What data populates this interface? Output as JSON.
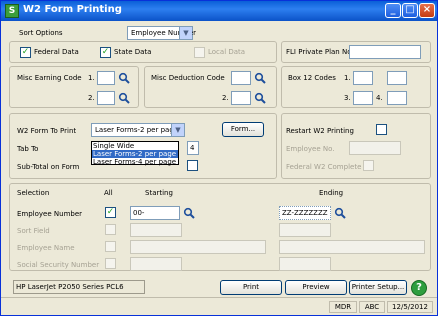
{
  "window": {
    "title": "W2 Form Printing"
  },
  "sort": {
    "label": "Sort Options",
    "value": "Employee Number"
  },
  "options": {
    "federal": "Federal Data",
    "state": "State Data",
    "local": "Local Data",
    "fli_label": "FLI Private Plan No.",
    "fli_value": ""
  },
  "misc_earning": {
    "label": "Misc Earning Code",
    "n1": "1.",
    "n2": "2."
  },
  "misc_deduction": {
    "label": "Misc Deduction Code",
    "n1": "1.",
    "n2": "2."
  },
  "box12": {
    "label": "Box 12 Codes",
    "n1": "1.",
    "n2": "2.",
    "n3": "3.",
    "n4": "4."
  },
  "print_opts": {
    "form_label": "W2 Form To Print",
    "form_value": "Laser Forms-2 per page",
    "tab_label": "Tab To",
    "tab_value": "4",
    "subtotal_label": "Sub-Total on Form",
    "form_btn": "Form...",
    "dropdown": [
      "Single Wide",
      "Laser Forms-2 per page",
      "Laser Forms-4 per page"
    ]
  },
  "restart": {
    "label": "Restart W2 Printing",
    "employee_label": "Employee No.",
    "federal_complete": "Federal W2 Complete"
  },
  "selection": {
    "header_selection": "Selection",
    "header_all": "All",
    "header_starting": "Starting",
    "header_ending": "Ending",
    "rows": [
      {
        "label": "Employee Number",
        "start": "00-",
        "end": "ZZ-ZZZZZZZ"
      },
      {
        "label": "Sort Field",
        "start": "",
        "end": ""
      },
      {
        "label": "Employee Name",
        "start": "",
        "end": ""
      },
      {
        "label": "Social Security Number",
        "start": "",
        "end": ""
      }
    ]
  },
  "printer": {
    "name": "HP LaserJet P2050 Series PCL6",
    "print": "Print",
    "preview": "Preview",
    "setup": "Printer Setup..."
  },
  "statusbar": {
    "mdr": "MDR",
    "abc": "ABC",
    "date": "12/5/2012"
  }
}
